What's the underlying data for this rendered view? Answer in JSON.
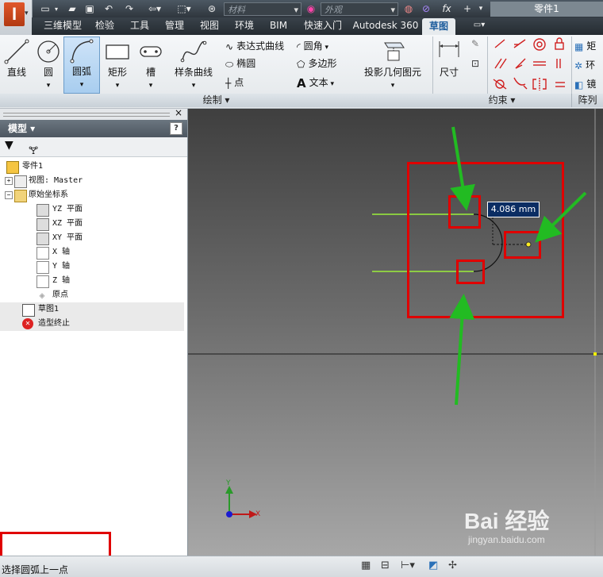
{
  "app": {
    "logo_letter": "I",
    "document_title": "零件1"
  },
  "quick_access": {
    "material_placeholder": "材料",
    "appearance_placeholder": "外观",
    "fx": "fx"
  },
  "menu_tabs": [
    "三维模型",
    "检验",
    "工具",
    "管理",
    "视图",
    "环境",
    "BIM",
    "快速入门",
    "Autodesk 360",
    "草图"
  ],
  "active_tab": "草图",
  "ribbon": {
    "draw": {
      "line": "直线",
      "circle": "圆",
      "arc": "圆弧",
      "rectangle": "矩形",
      "slot": "槽",
      "spline": "样条曲线",
      "equation_curve": "表达式曲线",
      "ellipse": "椭圆",
      "point": "点",
      "fillet": "圆角",
      "polygon": "多边形",
      "text": "文本",
      "project_geometry": "投影几何图元",
      "panel_label": "绘制 ▾"
    },
    "constrain": {
      "dimension": "尺寸",
      "panel_label": "约束 ▾"
    },
    "pattern": {
      "rect": "矩",
      "circ": "环",
      "mirror": "镜",
      "panel_label": "阵列"
    }
  },
  "browser": {
    "title": "模型 ▾",
    "help": "?",
    "items": [
      {
        "label": "零件1"
      },
      {
        "label": "视图: Master"
      },
      {
        "label": "原始坐标系"
      },
      {
        "label": "YZ 平面"
      },
      {
        "label": "XZ 平面"
      },
      {
        "label": "XY 平面"
      },
      {
        "label": "X 轴"
      },
      {
        "label": "Y 轴"
      },
      {
        "label": "Z 轴"
      },
      {
        "label": "原点"
      },
      {
        "label": "草图1"
      },
      {
        "label": "造型终止"
      }
    ]
  },
  "viewport": {
    "dimension_value": "4.086 mm",
    "axis_x": "X",
    "axis_y": "Y"
  },
  "status": {
    "prompt": "选择圆弧上一点"
  },
  "watermark": {
    "text": "Bai 经验",
    "url": "jingyan.baidu.com"
  },
  "colors": {
    "annotation_red": "#e00000",
    "annotation_green": "#22bb22",
    "sketch_green": "#9cef3a",
    "dim_blue": "#0b2d63"
  }
}
